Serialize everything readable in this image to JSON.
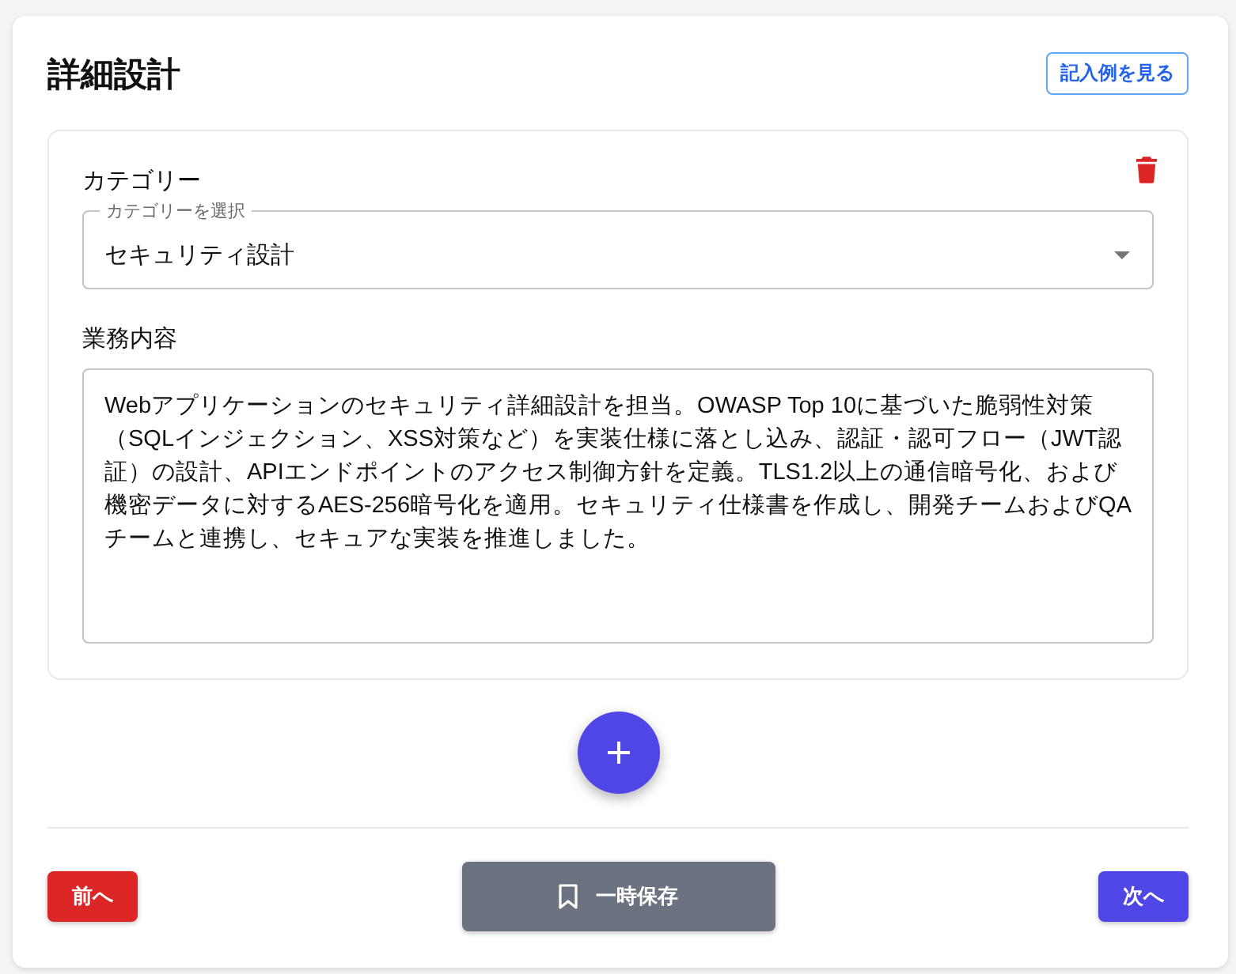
{
  "header": {
    "title": "詳細設計",
    "example_button": "記入例を見る"
  },
  "entries": [
    {
      "category_label": "カテゴリー",
      "category_select": {
        "label": "カテゴリーを選択",
        "value": "セキュリティ設計"
      },
      "description_label": "業務内容",
      "description": {
        "value": "Webアプリケーションのセキュリティ詳細設計を担当。OWASP Top 10に基づいた脆弱性対策（SQLインジェクション、XSS対策など）を実装仕様に落とし込み、認証・認可フロー（JWT認証）の設計、APIエンドポイントのアクセス制御方針を定義。TLS1.2以上の通信暗号化、および機密データに対するAES-256暗号化を適用。セキュリティ仕様書を作成し、開発チームおよびQAチームと連携し、セキュアな実装を推進しました。"
      }
    }
  ],
  "footer": {
    "prev_button": "前へ",
    "save_button": "一時保存",
    "next_button": "次へ"
  }
}
